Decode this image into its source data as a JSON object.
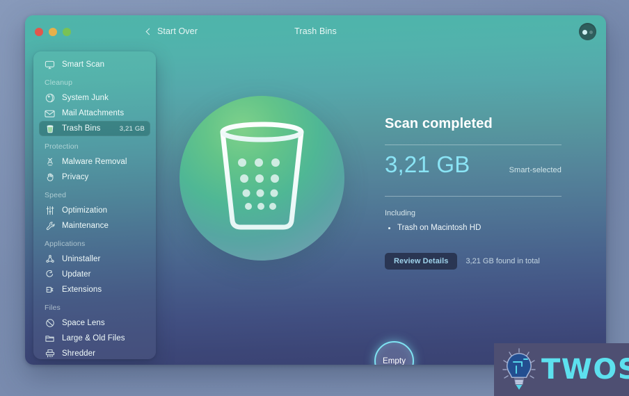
{
  "window": {
    "title": "Trash Bins",
    "back_label": "Start Over",
    "back_icon": "chevron-left-icon",
    "account_icon": "account-menu-icon",
    "traffic_lights": [
      "close",
      "minimize",
      "maximize"
    ]
  },
  "sidebar": {
    "items": [
      {
        "type": "item",
        "label": "Smart Scan",
        "icon": "smart-scan-icon",
        "size": "",
        "selected": false
      },
      {
        "type": "group",
        "label": "Cleanup"
      },
      {
        "type": "item",
        "label": "System Junk",
        "icon": "system-junk-icon",
        "size": "",
        "selected": false
      },
      {
        "type": "item",
        "label": "Mail Attachments",
        "icon": "mail-envelope-icon",
        "size": "",
        "selected": false
      },
      {
        "type": "item",
        "label": "Trash Bins",
        "icon": "trash-bin-icon",
        "size": "3,21 GB",
        "selected": true
      },
      {
        "type": "group",
        "label": "Protection"
      },
      {
        "type": "item",
        "label": "Malware Removal",
        "icon": "biohazard-icon",
        "size": "",
        "selected": false
      },
      {
        "type": "item",
        "label": "Privacy",
        "icon": "hand-privacy-icon",
        "size": "",
        "selected": false
      },
      {
        "type": "group",
        "label": "Speed"
      },
      {
        "type": "item",
        "label": "Optimization",
        "icon": "sliders-icon",
        "size": "",
        "selected": false
      },
      {
        "type": "item",
        "label": "Maintenance",
        "icon": "wrench-icon",
        "size": "",
        "selected": false
      },
      {
        "type": "group",
        "label": "Applications"
      },
      {
        "type": "item",
        "label": "Uninstaller",
        "icon": "uninstaller-icon",
        "size": "",
        "selected": false
      },
      {
        "type": "item",
        "label": "Updater",
        "icon": "updater-arrow-icon",
        "size": "",
        "selected": false
      },
      {
        "type": "item",
        "label": "Extensions",
        "icon": "extensions-icon",
        "size": "",
        "selected": false
      },
      {
        "type": "group",
        "label": "Files"
      },
      {
        "type": "item",
        "label": "Space Lens",
        "icon": "space-lens-icon",
        "size": "",
        "selected": false
      },
      {
        "type": "item",
        "label": "Large & Old Files",
        "icon": "folder-icon",
        "size": "",
        "selected": false
      },
      {
        "type": "item",
        "label": "Shredder",
        "icon": "shredder-icon",
        "size": "",
        "selected": false
      }
    ]
  },
  "main": {
    "hero_icon": "trash-bin-large-icon",
    "heading": "Scan completed",
    "size_value": "3,21 GB",
    "selection_mode": "Smart-selected",
    "including_label": "Including",
    "including_items": [
      "Trash on Macintosh HD"
    ],
    "review_button": "Review Details",
    "total_found": "3,21 GB found in total",
    "empty_button": "Empty"
  },
  "watermark": {
    "text": "TWOS",
    "icon": "lightbulb-circuit-icon"
  },
  "colors": {
    "accent_cyan": "#8ae4f5",
    "empty_ring": "#7fe3f2",
    "sidebar_selected": "#14564c",
    "review_button_bg": "#2a3653",
    "twos_cyan": "#5de0ee",
    "twos_bg": "#4e4f72"
  }
}
